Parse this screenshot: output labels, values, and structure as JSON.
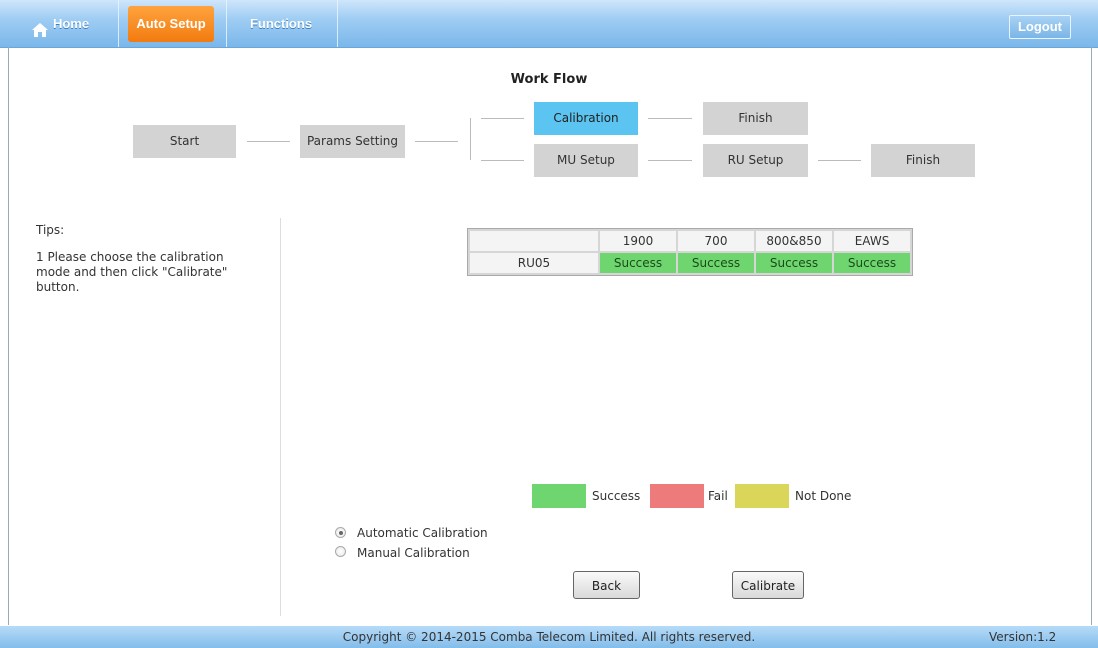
{
  "nav": {
    "home_label": "Home",
    "auto_setup_label": "Auto Setup",
    "functions_label": "Functions",
    "logout_label": "Logout",
    "active_color": "#f27b10"
  },
  "workflow": {
    "title": "Work Flow",
    "start": "Start",
    "params_setting": "Params Setting",
    "calibration": "Calibration",
    "finish_top": "Finish",
    "mu_setup": "MU Setup",
    "ru_setup": "RU Setup",
    "finish_bottom": "Finish",
    "active_step": "Calibration",
    "active_color": "#5bc4f1"
  },
  "tips": {
    "title": "Tips:",
    "text": "1 Please choose the calibration mode and then click \"Calibrate\" button."
  },
  "results": {
    "columns": [
      "",
      "1900",
      "700",
      "800&850",
      "EAWS"
    ],
    "rows": [
      {
        "name": "RU05",
        "values": [
          "Success",
          "Success",
          "Success",
          "Success"
        ]
      }
    ]
  },
  "legend": {
    "success_label": "Success",
    "fail_label": "Fail",
    "not_done_label": "Not Done",
    "success_color": "#6fd66f",
    "fail_color": "#ee7b7b",
    "not_done_color": "#d9d65a"
  },
  "mode": {
    "automatic_label": "Automatic Calibration",
    "manual_label": "Manual Calibration",
    "selected": "Automatic Calibration"
  },
  "buttons": {
    "back_label": "Back",
    "calibrate_label": "Calibrate"
  },
  "footer": {
    "copyright": "Copyright © 2014-2015 Comba Telecom Limited. All rights reserved.",
    "version": "Version:1.2"
  }
}
